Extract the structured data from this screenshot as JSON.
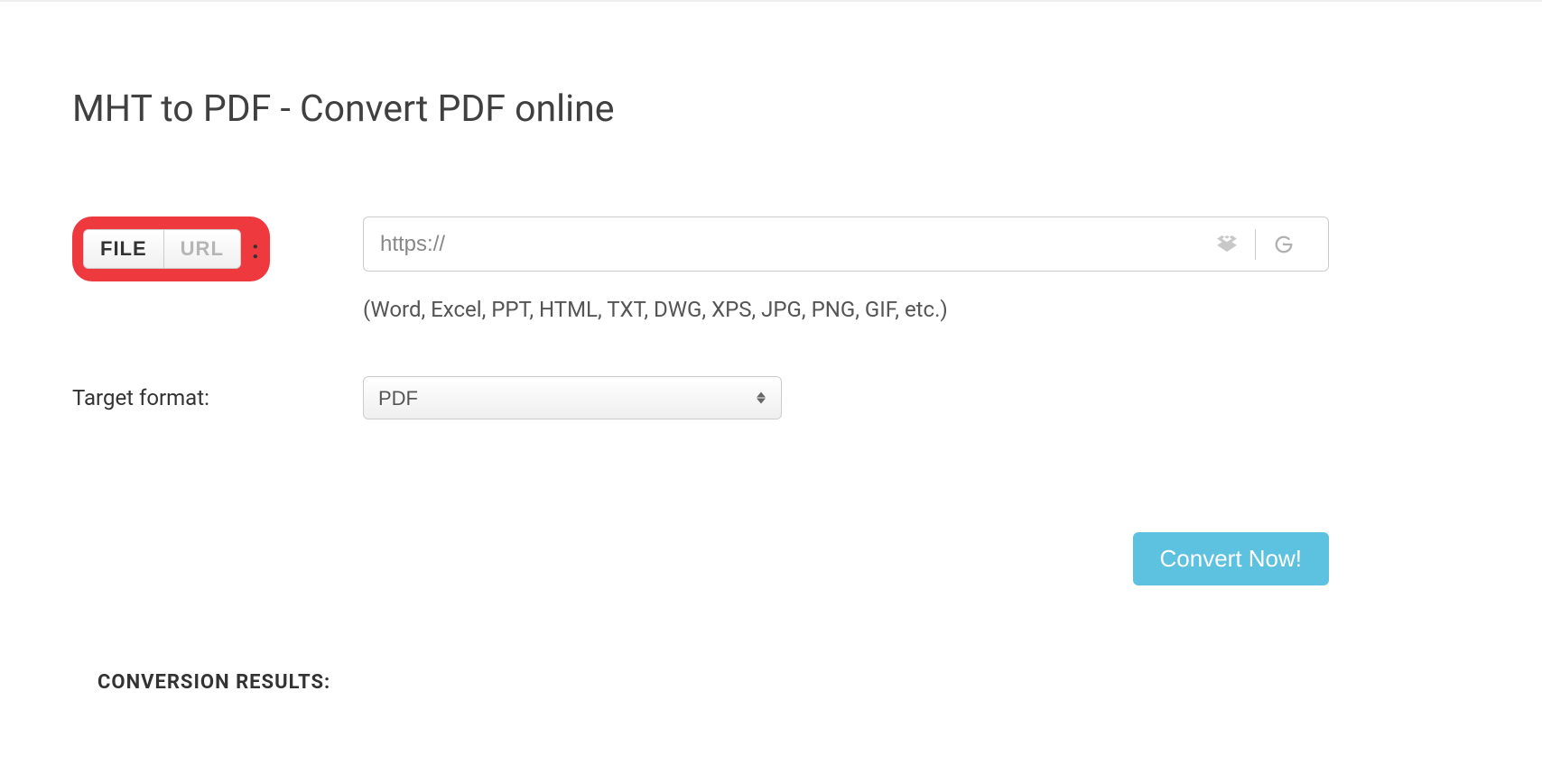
{
  "title": "MHT to PDF - Convert PDF online",
  "source": {
    "file_tab": "FILE",
    "url_tab": "URL",
    "colon": ":",
    "url_placeholder": "https://",
    "hint": "(Word, Excel, PPT, HTML, TXT, DWG, XPS, JPG, PNG, GIF, etc.)"
  },
  "target": {
    "label": "Target format:",
    "selected": "PDF"
  },
  "convert_button": "Convert Now!",
  "results_heading": "CONVERSION RESULTS:"
}
